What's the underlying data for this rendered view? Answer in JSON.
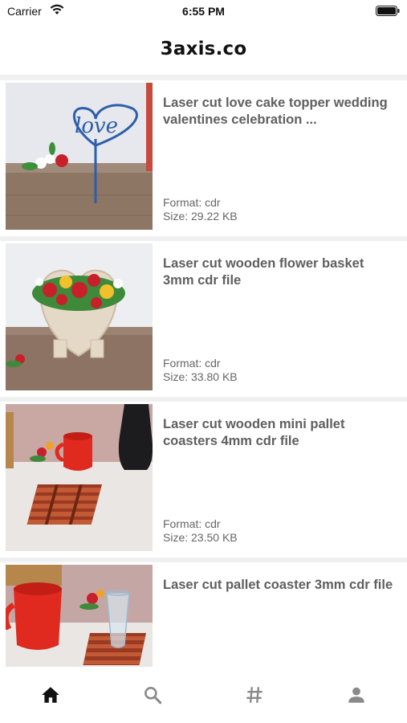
{
  "status_bar": {
    "carrier": "Carrier",
    "time": "6:55 PM"
  },
  "header": {
    "title": "3axis.co"
  },
  "items": [
    {
      "title": "Laser cut love cake topper wedding valentines celebration ...",
      "format": "Format: cdr",
      "size": "Size: 29.22 KB"
    },
    {
      "title": "Laser cut wooden flower basket 3mm cdr file",
      "format": "Format: cdr",
      "size": "Size: 33.80 KB"
    },
    {
      "title": "Laser cut wooden mini pallet coasters 4mm cdr file",
      "format": "Format: cdr",
      "size": "Size: 23.50 KB"
    },
    {
      "title": "Laser cut pallet coaster 3mm cdr file",
      "format": "",
      "size": ""
    }
  ],
  "tabbar": {
    "tabs": [
      {
        "icon": "home-icon",
        "active": true
      },
      {
        "icon": "search-icon",
        "active": false
      },
      {
        "icon": "hashtag-icon",
        "active": false
      },
      {
        "icon": "profile-icon",
        "active": false
      }
    ]
  },
  "colors": {
    "active_tab": "#111111",
    "inactive_tab": "#8a8a8a",
    "title_text": "#5f5f5f"
  }
}
